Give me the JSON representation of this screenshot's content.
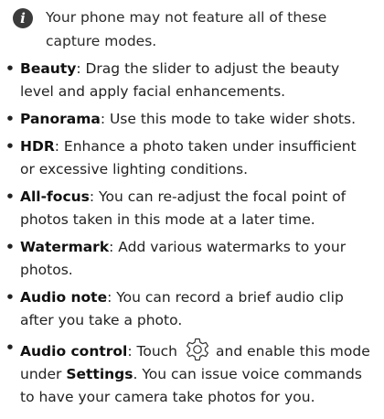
{
  "note": {
    "icon": "info-icon",
    "icon_glyph": "i",
    "text": "Your phone may not feature all of these capture modes."
  },
  "bullet": "•",
  "items": [
    {
      "term": "Beauty",
      "text": ": Drag the slider to adjust the beauty level and apply facial enhancements."
    },
    {
      "term": "Panorama",
      "text": ": Use this mode to take wider shots."
    },
    {
      "term": "HDR",
      "text": ": Enhance a photo taken under insufficient or excessive lighting conditions."
    },
    {
      "term": "All-focus",
      "text": ": You can re-adjust the focal point of photos taken in this mode at a later time."
    },
    {
      "term": "Watermark",
      "text": ": Add various watermarks to your photos."
    },
    {
      "term": "Audio note",
      "text": ": You can record a brief audio clip after you take a photo."
    }
  ],
  "audio_control": {
    "term": "Audio control",
    "text_before": ": Touch",
    "icon": "settings-gear-icon",
    "text_middle": "and enable this mode under",
    "settings_label": "Settings",
    "text_after": ". You can issue voice commands to have your camera take photos for you."
  }
}
